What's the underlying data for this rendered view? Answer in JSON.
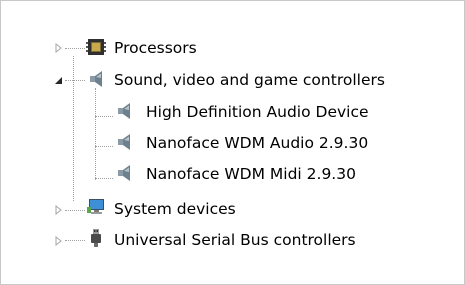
{
  "tree": {
    "nodes": [
      {
        "id": "processors",
        "label": "Processors",
        "icon": "processor-icon",
        "expanded": false
      },
      {
        "id": "sound",
        "label": "Sound, video and game controllers",
        "icon": "speaker-icon",
        "expanded": true,
        "children": [
          {
            "label": "High Definition Audio Device",
            "icon": "speaker-icon"
          },
          {
            "label": "Nanoface WDM Audio 2.9.30",
            "icon": "speaker-icon"
          },
          {
            "label": "Nanoface WDM Midi 2.9.30",
            "icon": "speaker-icon"
          }
        ]
      },
      {
        "id": "system",
        "label": "System devices",
        "icon": "computer-icon",
        "expanded": false
      },
      {
        "id": "usb",
        "label": "Universal Serial Bus controllers",
        "icon": "usb-plug-icon",
        "expanded": false
      }
    ]
  }
}
